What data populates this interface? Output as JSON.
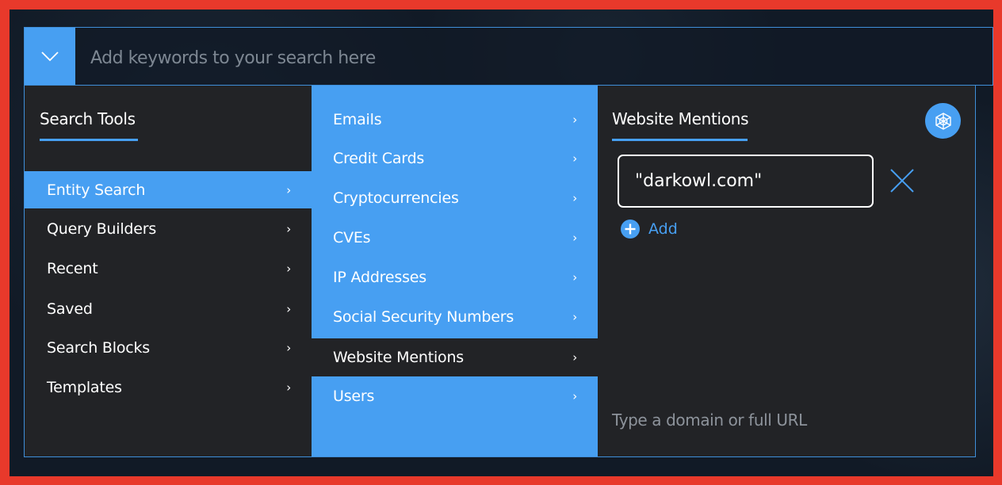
{
  "search": {
    "placeholder": "Add keywords to your search here"
  },
  "search_tools": {
    "heading": "Search Tools",
    "items": [
      {
        "label": "Entity Search",
        "active": true
      },
      {
        "label": "Query Builders",
        "active": false
      },
      {
        "label": "Recent",
        "active": false
      },
      {
        "label": "Saved",
        "active": false
      },
      {
        "label": "Search Blocks",
        "active": false
      },
      {
        "label": "Templates",
        "active": false
      }
    ]
  },
  "entity_types": {
    "items": [
      {
        "label": "Emails"
      },
      {
        "label": "Credit Cards"
      },
      {
        "label": "Cryptocurrencies"
      },
      {
        "label": "CVEs"
      },
      {
        "label": "IP Addresses"
      },
      {
        "label": "Social Security Numbers"
      },
      {
        "label": "Website Mentions",
        "active": true
      },
      {
        "label": "Users"
      }
    ]
  },
  "website_mentions": {
    "heading": "Website Mentions",
    "domain_value": "\"darkowl.com\"",
    "add_label": "Add",
    "hint": "Type a domain or full URL"
  },
  "icons": {
    "toggle": "chevron-down-icon",
    "chevron": "chevron-right-icon",
    "network": "network-icon",
    "clear": "close-icon",
    "add": "plus-circle-icon"
  },
  "colors": {
    "accent": "#479ff2",
    "panel": "#222326",
    "border": "#3f8fd9",
    "frame": "#e8392b"
  },
  "chevron_glyph": "›"
}
